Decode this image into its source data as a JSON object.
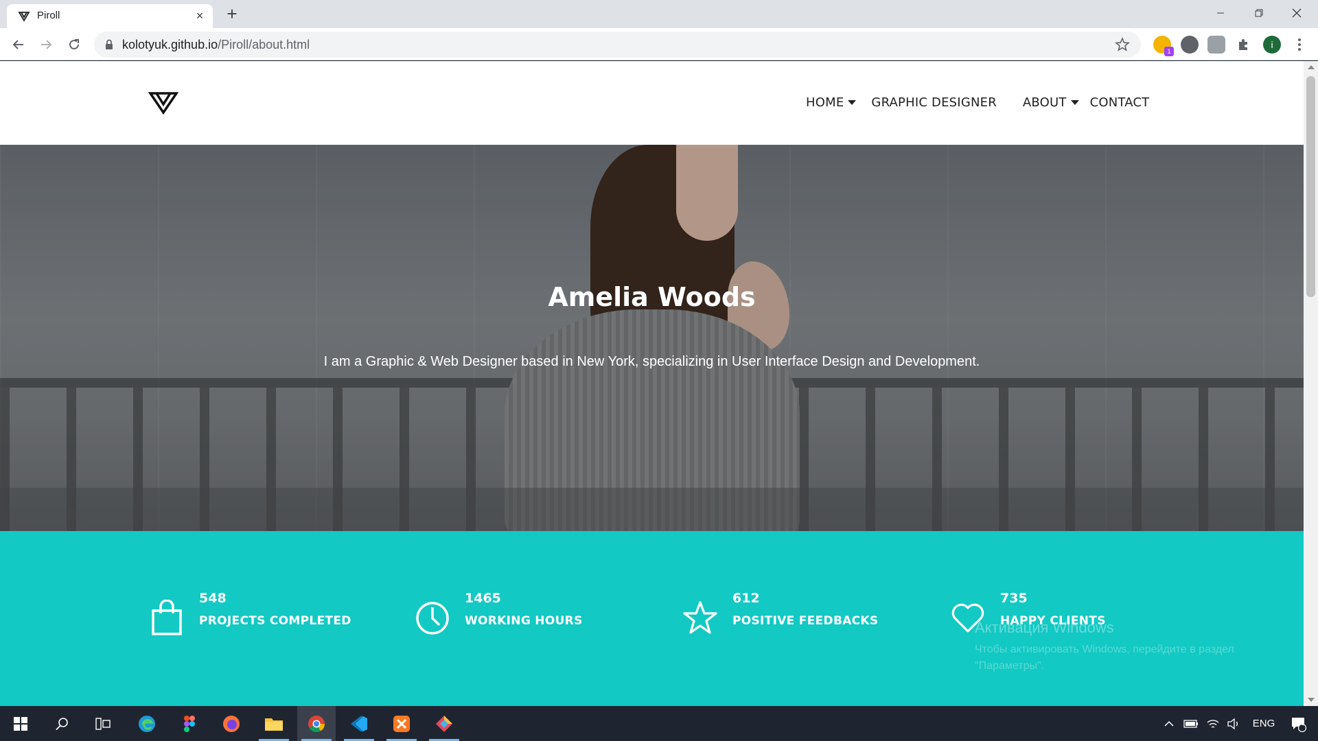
{
  "browser": {
    "tab_title": "Piroll",
    "url_host": "kolotyuk.github.io",
    "url_path": "/Piroll/about.html",
    "ext_badge": "1",
    "profile_initial": "i"
  },
  "site": {
    "nav": {
      "home": "HOME",
      "graphic_designer": "GRAPHIC DESIGNER",
      "about": "ABOUT",
      "contact": "CONTACT"
    },
    "hero": {
      "title": "Amelia Woods",
      "subtitle": "I am a Graphic & Web Designer based in New York, specializing in User Interface Design and Development."
    },
    "stats": [
      {
        "icon": "shopping-bag-icon",
        "value": "548",
        "label": "PROJECTS COMPLETED"
      },
      {
        "icon": "clock-icon",
        "value": "1465",
        "label": "WORKING HOURS"
      },
      {
        "icon": "star-icon",
        "value": "612",
        "label": "POSITIVE FEEDBACKS"
      },
      {
        "icon": "heart-icon",
        "value": "735",
        "label": "HAPPY CLIENTS"
      }
    ],
    "accent_color": "#12c9c4"
  },
  "os": {
    "watermark_title": "Активация Windows",
    "watermark_line1": "Чтобы активировать Windows, перейдите в раздел",
    "watermark_line2": "\"Параметры\".",
    "language": "ENG",
    "notifications": "1"
  }
}
